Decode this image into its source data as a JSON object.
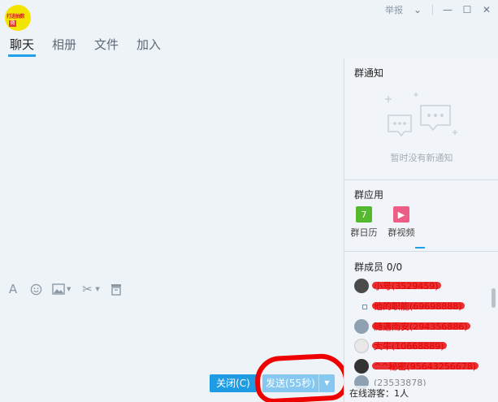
{
  "window": {
    "group_name": "",
    "logo_text": "打进抽数",
    "logo_badge": "微",
    "report": "举报",
    "controls": [
      "chevron-down",
      "minimize",
      "maximize",
      "close"
    ]
  },
  "tabs": [
    "聊天",
    "相册",
    "文件",
    "加入"
  ],
  "active_tab": 0,
  "toolbar": {
    "font_icon": "A",
    "icons": [
      "font-icon",
      "emoji-icon",
      "image-icon",
      "scissors-icon",
      "history-icon"
    ]
  },
  "buttons": {
    "close": "关闭(C)",
    "send": "发送(55秒)",
    "send_arrow": "▼"
  },
  "notice": {
    "title": "群通知",
    "empty": "暂时没有新通知"
  },
  "apps": {
    "title": "群应用",
    "items": [
      {
        "label": "群日历",
        "glyph": "7"
      },
      {
        "label": "群视频",
        "glyph": "▶"
      }
    ]
  },
  "members": {
    "title": "群成员 0/0",
    "list": [
      {
        "name": "小号(3529459)"
      },
      {
        "name": "他的职能(69698888)"
      },
      {
        "name": "随遇而安(294356886)"
      },
      {
        "name": "大牛(10668889)"
      },
      {
        "name": "^^秘密(95643256678)"
      },
      {
        "name": "(23533878)"
      }
    ]
  },
  "visitors": "在线游客：1人"
}
